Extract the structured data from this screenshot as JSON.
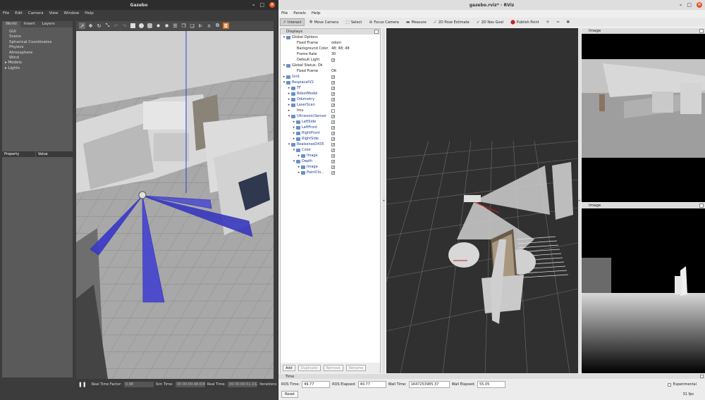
{
  "gazebo": {
    "title": "Gazebo",
    "menu": [
      "File",
      "Edit",
      "Camera",
      "View",
      "Window",
      "Help"
    ],
    "tabs": [
      "World",
      "Insert",
      "Layers"
    ],
    "tree": [
      "GUI",
      "Scene",
      "Spherical Coordinates",
      "Physics",
      "Atmosphere",
      "Wind",
      "Models",
      "Lights"
    ],
    "prop_headers": [
      "Property",
      "Value"
    ],
    "status": {
      "real_time_factor_label": "Real Time Factor:",
      "real_time_factor": "0.98",
      "sim_time_label": "Sim Time:",
      "sim_time": "00 00:00:48.636",
      "real_time_label": "Real Time:",
      "real_time": "00 00:00:51.102",
      "iterations_label": "Iterations:"
    }
  },
  "rviz": {
    "title": "gazebo.rviz* - RViz",
    "menu": [
      "File",
      "Panels",
      "Help"
    ],
    "tools": [
      "Interact",
      "Move Camera",
      "Select",
      "Focus Camera",
      "Measure",
      "2D Pose Estimate",
      "2D Nav Goal",
      "Publish Point"
    ],
    "displays_title": "Displays",
    "displays": [
      {
        "depth": 0,
        "arrow": "▾",
        "name": "Global Options",
        "value": "",
        "check": null
      },
      {
        "depth": 1,
        "arrow": "",
        "name": "Fixed Frame",
        "value": "odom",
        "check": null
      },
      {
        "depth": 1,
        "arrow": "",
        "name": "Background Color",
        "value": "48; 48; 48",
        "check": null
      },
      {
        "depth": 1,
        "arrow": "",
        "name": "Frame Rate",
        "value": "30",
        "check": null
      },
      {
        "depth": 1,
        "arrow": "",
        "name": "Default Light",
        "value": "",
        "check": true
      },
      {
        "depth": 0,
        "arrow": "▾",
        "name": "Global Status: Ok",
        "value": "",
        "check": null
      },
      {
        "depth": 1,
        "arrow": "",
        "name": "Fixed Frame",
        "value": "OK",
        "check": null
      },
      {
        "depth": 0,
        "arrow": "▸",
        "name": "Grid",
        "value": "",
        "check": true,
        "blue": true
      },
      {
        "depth": 0,
        "arrow": "▾",
        "name": "RospiacatV2",
        "value": "",
        "check": true,
        "blue": true
      },
      {
        "depth": 1,
        "arrow": "▸",
        "name": "TF",
        "value": "",
        "check": true,
        "blue": true
      },
      {
        "depth": 1,
        "arrow": "▸",
        "name": "RobotModel",
        "value": "",
        "check": true,
        "blue": true
      },
      {
        "depth": 1,
        "arrow": "▸",
        "name": "Odometry",
        "value": "",
        "check": true,
        "blue": true
      },
      {
        "depth": 1,
        "arrow": "▸",
        "name": "LaserScan",
        "value": "",
        "check": true,
        "blue": true
      },
      {
        "depth": 1,
        "arrow": "▸",
        "name": "Imu",
        "value": "",
        "check": false
      },
      {
        "depth": 1,
        "arrow": "▾",
        "name": "UltrasonicSensor",
        "value": "",
        "check": true,
        "blue": true
      },
      {
        "depth": 2,
        "arrow": "▸",
        "name": "LeftSide",
        "value": "",
        "check": true,
        "blue": true
      },
      {
        "depth": 2,
        "arrow": "▸",
        "name": "LeftFront",
        "value": "",
        "check": true,
        "blue": true
      },
      {
        "depth": 2,
        "arrow": "▸",
        "name": "RightFront",
        "value": "",
        "check": true,
        "blue": true
      },
      {
        "depth": 2,
        "arrow": "▸",
        "name": "RightSide",
        "value": "",
        "check": true,
        "blue": true
      },
      {
        "depth": 1,
        "arrow": "▾",
        "name": "RealsenseD435",
        "value": "",
        "check": true,
        "blue": true
      },
      {
        "depth": 2,
        "arrow": "▾",
        "name": "Color",
        "value": "",
        "check": true,
        "blue": true
      },
      {
        "depth": 3,
        "arrow": "▸",
        "name": "Image",
        "value": "",
        "check": true,
        "blue": true
      },
      {
        "depth": 2,
        "arrow": "▾",
        "name": "Depth",
        "value": "",
        "check": true,
        "blue": true
      },
      {
        "depth": 3,
        "arrow": "▸",
        "name": "Image",
        "value": "",
        "check": true,
        "blue": true
      },
      {
        "depth": 3,
        "arrow": "▸",
        "name": "PointClo...",
        "value": "",
        "check": true,
        "blue": true
      }
    ],
    "buttons": [
      "Add",
      "Duplicate",
      "Remove",
      "Rename"
    ],
    "image_panel_1": "Image",
    "image_panel_2": "Image",
    "time": {
      "title": "Time",
      "ros_time_label": "ROS Time:",
      "ros_time": "49.77",
      "ros_elapsed_label": "ROS Elapsed:",
      "ros_elapsed": "49.77",
      "wall_time_label": "Wall Time:",
      "wall_time": "1647253985.37",
      "wall_elapsed_label": "Wall Elapsed:",
      "wall_elapsed": "55.05",
      "experimental": "Experimental",
      "reset": "Reset",
      "fps": "31 fps"
    }
  }
}
